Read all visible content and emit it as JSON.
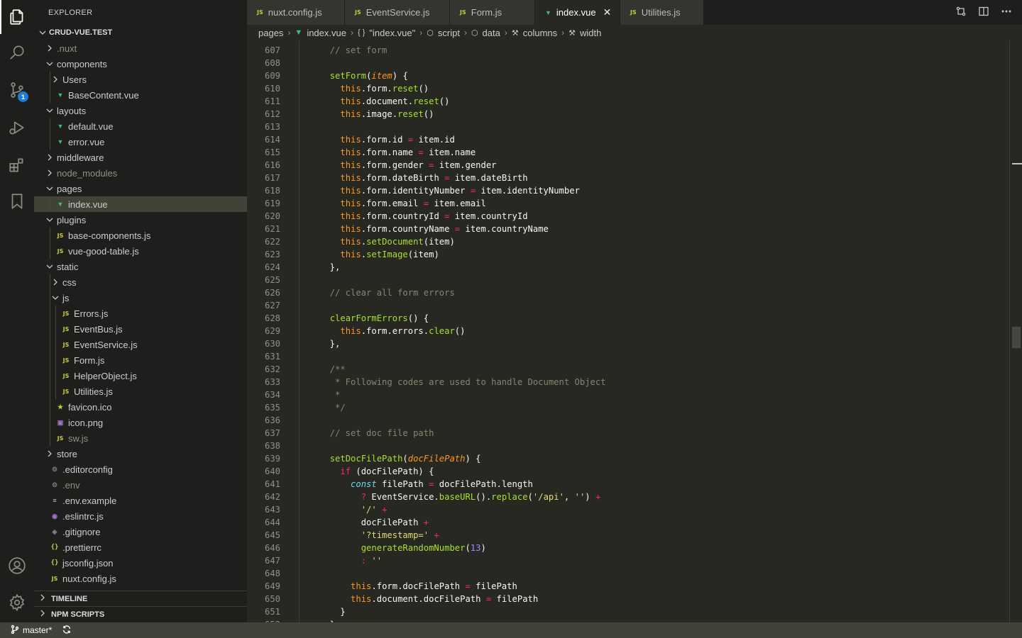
{
  "sidebar": {
    "title": "EXPLORER",
    "root": "CRUD-VUE.TEST",
    "items": [
      {
        "label": ".nuxt",
        "type": "folder",
        "open": false,
        "depth": 1,
        "dim": true
      },
      {
        "label": "components",
        "type": "folder",
        "open": true,
        "depth": 1
      },
      {
        "label": "Users",
        "type": "folder",
        "open": false,
        "depth": 2
      },
      {
        "label": "BaseContent.vue",
        "type": "vue",
        "depth": 2
      },
      {
        "label": "layouts",
        "type": "folder",
        "open": true,
        "depth": 1
      },
      {
        "label": "default.vue",
        "type": "vue",
        "depth": 2
      },
      {
        "label": "error.vue",
        "type": "vue",
        "depth": 2
      },
      {
        "label": "middleware",
        "type": "folder",
        "open": false,
        "depth": 1
      },
      {
        "label": "node_modules",
        "type": "folder",
        "open": false,
        "depth": 1,
        "dim": true
      },
      {
        "label": "pages",
        "type": "folder",
        "open": true,
        "depth": 1
      },
      {
        "label": "index.vue",
        "type": "vue",
        "depth": 2,
        "selected": true
      },
      {
        "label": "plugins",
        "type": "folder",
        "open": true,
        "depth": 1
      },
      {
        "label": "base-components.js",
        "type": "js",
        "depth": 2
      },
      {
        "label": "vue-good-table.js",
        "type": "js",
        "depth": 2
      },
      {
        "label": "static",
        "type": "folder",
        "open": true,
        "depth": 1
      },
      {
        "label": "css",
        "type": "folder",
        "open": false,
        "depth": 2
      },
      {
        "label": "js",
        "type": "folder",
        "open": true,
        "depth": 2
      },
      {
        "label": "Errors.js",
        "type": "js",
        "depth": 3
      },
      {
        "label": "EventBus.js",
        "type": "js",
        "depth": 3
      },
      {
        "label": "EventService.js",
        "type": "js",
        "depth": 3
      },
      {
        "label": "Form.js",
        "type": "js",
        "depth": 3
      },
      {
        "label": "HelperObject.js",
        "type": "js",
        "depth": 3
      },
      {
        "label": "Utilities.js",
        "type": "js",
        "depth": 3
      },
      {
        "label": "favicon.ico",
        "type": "star",
        "depth": 2
      },
      {
        "label": "icon.png",
        "type": "img",
        "depth": 2
      },
      {
        "label": "sw.js",
        "type": "js",
        "depth": 2,
        "dim": true
      },
      {
        "label": "store",
        "type": "folder",
        "open": false,
        "depth": 1
      },
      {
        "label": ".editorconfig",
        "type": "gear",
        "depth": 1
      },
      {
        "label": ".env",
        "type": "gear",
        "depth": 1,
        "dim": true
      },
      {
        "label": ".env.example",
        "type": "lines",
        "depth": 1
      },
      {
        "label": ".eslintrc.js",
        "type": "eslint",
        "depth": 1
      },
      {
        "label": ".gitignore",
        "type": "git",
        "depth": 1
      },
      {
        "label": ".prettierrc",
        "type": "brace",
        "depth": 1
      },
      {
        "label": "jsconfig.json",
        "type": "brace",
        "depth": 1
      },
      {
        "label": "nuxt.config.js",
        "type": "js",
        "depth": 1
      }
    ],
    "timeline": "TIMELINE",
    "npm_scripts": "NPM SCRIPTS"
  },
  "tabs": [
    {
      "label": "nuxt.config.js",
      "type": "js",
      "width": 138
    },
    {
      "label": "EventService.js",
      "type": "js",
      "width": 148
    },
    {
      "label": "Form.js",
      "type": "js",
      "width": 120
    },
    {
      "label": "index.vue",
      "type": "vue",
      "width": 120,
      "active": true
    },
    {
      "label": "Utilities.js",
      "type": "js",
      "width": 118
    }
  ],
  "breadcrumb": [
    {
      "label": "pages",
      "icon": ""
    },
    {
      "label": "index.vue",
      "icon": "vue"
    },
    {
      "label": "\"index.vue\"",
      "icon": "{}"
    },
    {
      "label": "script",
      "icon": "cube"
    },
    {
      "label": "data",
      "icon": "cube"
    },
    {
      "label": "columns",
      "icon": "wrench"
    },
    {
      "label": "width",
      "icon": "wrench"
    }
  ],
  "editor": {
    "first_line": 607,
    "lines": [
      [
        [
          "t-cm",
          "  // set form"
        ]
      ],
      [],
      [
        [
          "",
          "  "
        ],
        [
          "t-fn",
          "setForm"
        ],
        [
          "",
          "("
        ],
        [
          "t-ital",
          "item"
        ],
        [
          "",
          ") {"
        ]
      ],
      [
        [
          "",
          "    "
        ],
        [
          "t-this",
          "this"
        ],
        [
          "",
          ".form."
        ],
        [
          "t-fn",
          "reset"
        ],
        [
          "",
          "()"
        ]
      ],
      [
        [
          "",
          "    "
        ],
        [
          "t-this",
          "this"
        ],
        [
          "",
          ".document."
        ],
        [
          "t-fn",
          "reset"
        ],
        [
          "",
          "()"
        ]
      ],
      [
        [
          "",
          "    "
        ],
        [
          "t-this",
          "this"
        ],
        [
          "",
          ".image."
        ],
        [
          "t-fn",
          "reset"
        ],
        [
          "",
          "()"
        ]
      ],
      [],
      [
        [
          "",
          "    "
        ],
        [
          "t-this",
          "this"
        ],
        [
          "",
          ".form.id "
        ],
        [
          "t-kw",
          "="
        ],
        [
          "",
          " item.id"
        ]
      ],
      [
        [
          "",
          "    "
        ],
        [
          "t-this",
          "this"
        ],
        [
          "",
          ".form.name "
        ],
        [
          "t-kw",
          "="
        ],
        [
          "",
          " item.name"
        ]
      ],
      [
        [
          "",
          "    "
        ],
        [
          "t-this",
          "this"
        ],
        [
          "",
          ".form.gender "
        ],
        [
          "t-kw",
          "="
        ],
        [
          "",
          " item.gender"
        ]
      ],
      [
        [
          "",
          "    "
        ],
        [
          "t-this",
          "this"
        ],
        [
          "",
          ".form.dateBirth "
        ],
        [
          "t-kw",
          "="
        ],
        [
          "",
          " item.dateBirth"
        ]
      ],
      [
        [
          "",
          "    "
        ],
        [
          "t-this",
          "this"
        ],
        [
          "",
          ".form.identityNumber "
        ],
        [
          "t-kw",
          "="
        ],
        [
          "",
          " item.identityNumber"
        ]
      ],
      [
        [
          "",
          "    "
        ],
        [
          "t-this",
          "this"
        ],
        [
          "",
          ".form.email "
        ],
        [
          "t-kw",
          "="
        ],
        [
          "",
          " item.email"
        ]
      ],
      [
        [
          "",
          "    "
        ],
        [
          "t-this",
          "this"
        ],
        [
          "",
          ".form.countryId "
        ],
        [
          "t-kw",
          "="
        ],
        [
          "",
          " item.countryId"
        ]
      ],
      [
        [
          "",
          "    "
        ],
        [
          "t-this",
          "this"
        ],
        [
          "",
          ".form.countryName "
        ],
        [
          "t-kw",
          "="
        ],
        [
          "",
          " item.countryName"
        ]
      ],
      [
        [
          "",
          "    "
        ],
        [
          "t-this",
          "this"
        ],
        [
          "",
          "."
        ],
        [
          "t-fn",
          "setDocument"
        ],
        [
          "",
          "(item)"
        ]
      ],
      [
        [
          "",
          "    "
        ],
        [
          "t-this",
          "this"
        ],
        [
          "",
          "."
        ],
        [
          "t-fn",
          "setImage"
        ],
        [
          "",
          "(item)"
        ]
      ],
      [
        [
          "",
          "  },"
        ]
      ],
      [],
      [
        [
          "t-cm",
          "  // clear all form errors"
        ]
      ],
      [],
      [
        [
          "",
          "  "
        ],
        [
          "t-fn",
          "clearFormErrors"
        ],
        [
          "",
          "() {"
        ]
      ],
      [
        [
          "",
          "    "
        ],
        [
          "t-this",
          "this"
        ],
        [
          "",
          ".form.errors."
        ],
        [
          "t-fn",
          "clear"
        ],
        [
          "",
          "()"
        ]
      ],
      [
        [
          "",
          "  },"
        ]
      ],
      [],
      [
        [
          "t-cm",
          "  /**"
        ]
      ],
      [
        [
          "t-cm",
          "   * Following codes are used to handle Document Object"
        ]
      ],
      [
        [
          "t-cm",
          "   *"
        ]
      ],
      [
        [
          "t-cm",
          "   */"
        ]
      ],
      [],
      [
        [
          "t-cm",
          "  // set doc file path"
        ]
      ],
      [],
      [
        [
          "",
          "  "
        ],
        [
          "t-fn",
          "setDocFilePath"
        ],
        [
          "",
          "("
        ],
        [
          "t-ital",
          "docFilePath"
        ],
        [
          "",
          ") {"
        ]
      ],
      [
        [
          "",
          "    "
        ],
        [
          "t-kw",
          "if"
        ],
        [
          "",
          " (docFilePath) {"
        ]
      ],
      [
        [
          "",
          "      "
        ],
        [
          "t-const",
          "const"
        ],
        [
          "",
          " filePath "
        ],
        [
          "t-kw",
          "="
        ],
        [
          "",
          " docFilePath.length"
        ]
      ],
      [
        [
          "",
          "        "
        ],
        [
          "t-kw",
          "?"
        ],
        [
          "",
          " EventService."
        ],
        [
          "t-fn",
          "baseURL"
        ],
        [
          "",
          "()."
        ],
        [
          "t-fn",
          "replace"
        ],
        [
          "",
          "("
        ],
        [
          "t-str",
          "'/api'"
        ],
        [
          "",
          ", "
        ],
        [
          "t-str",
          "''"
        ],
        [
          "",
          ") "
        ],
        [
          "t-kw",
          "+"
        ]
      ],
      [
        [
          "",
          "        "
        ],
        [
          "t-str",
          "'/'"
        ],
        [
          "",
          " "
        ],
        [
          "t-kw",
          "+"
        ]
      ],
      [
        [
          "",
          "        docFilePath "
        ],
        [
          "t-kw",
          "+"
        ]
      ],
      [
        [
          "",
          "        "
        ],
        [
          "t-str",
          "'?timestamp='"
        ],
        [
          "",
          " "
        ],
        [
          "t-kw",
          "+"
        ]
      ],
      [
        [
          "",
          "        "
        ],
        [
          "t-fn",
          "generateRandomNumber"
        ],
        [
          "",
          "("
        ],
        [
          "t-num",
          "13"
        ],
        [
          "",
          ")"
        ]
      ],
      [
        [
          "",
          "        "
        ],
        [
          "t-kw",
          ":"
        ],
        [
          "",
          " "
        ],
        [
          "t-str",
          "''"
        ]
      ],
      [],
      [
        [
          "",
          "      "
        ],
        [
          "t-this",
          "this"
        ],
        [
          "",
          ".form.docFilePath "
        ],
        [
          "t-kw",
          "="
        ],
        [
          "",
          " filePath"
        ]
      ],
      [
        [
          "",
          "      "
        ],
        [
          "t-this",
          "this"
        ],
        [
          "",
          ".document.docFilePath "
        ],
        [
          "t-kw",
          "="
        ],
        [
          "",
          " filePath"
        ]
      ],
      [
        [
          "",
          "    }"
        ]
      ],
      [
        [
          "",
          "  }"
        ]
      ]
    ]
  },
  "status": {
    "branch": "master*"
  }
}
